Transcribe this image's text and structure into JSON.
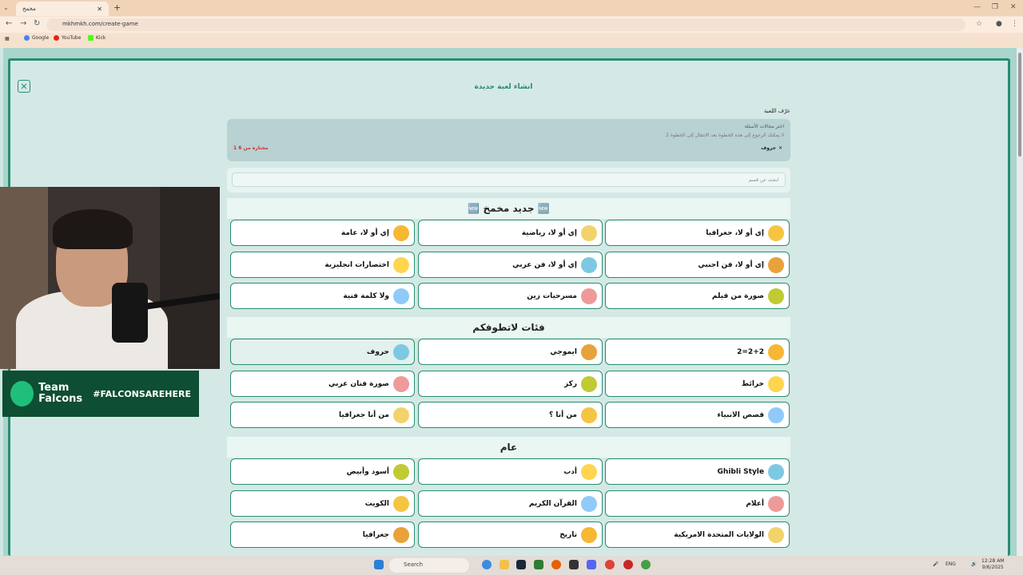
{
  "browser": {
    "tab_title": "مخمخ",
    "url": "mkhmkh.com/create-game",
    "bookmarks": [
      "Google",
      "YouTube",
      "Kick"
    ]
  },
  "page": {
    "title": "انشاء لعبة جديدة",
    "game_name_label": "عرّف اللعبة",
    "select_heading": "اختر مجالات الأسئلة",
    "select_note": "لا يمكنك الرجوع إلى هذه الخطوة بعد الانتقال إلى الخطوة 2",
    "selected_item": "حروف",
    "selected_count": "1 مختاره من 6",
    "search_placeholder": "ابحث عن قسم"
  },
  "sections": [
    {
      "title": "🆕 جديد مخمخ 🆕",
      "items": [
        "إي أو لا، جغرافيا",
        "إي أو لا، رياضية",
        "إي أو لا، عامة",
        "إي أو لا، فن اجنبي",
        "إي أو لا، فن عربي",
        "اختصارات انجليزية",
        "صورة من فيلم",
        "مسرحيات زين",
        "ولا كلمة فنية"
      ]
    },
    {
      "title": "فئات لاتطوفكم",
      "items": [
        "2=2+2",
        "ايموجي",
        "حروف",
        "خرائط",
        "ركز",
        "صورة فنان عربي",
        "قصص الانبياء",
        "من أنا ؟",
        "من أنا جغرافيا"
      ]
    },
    {
      "title": "عام",
      "items": [
        "Ghibli Style",
        "أدب",
        "أسود وأبيض",
        "أعلام",
        "القرآن الكريم",
        "الكويت",
        "الولايات المتحدة الامريكية",
        "تاريخ",
        "جغرافيا"
      ]
    }
  ],
  "stream": {
    "team": "Team Falcons",
    "hashtag": "#FALCONSAREHERE"
  },
  "taskbar": {
    "search": "Search",
    "lang": "ENG",
    "time": "12:28 AM",
    "date": "9/6/2025"
  },
  "colors": {
    "accent": "#2a8c71",
    "selected_count": "#d32f2f"
  }
}
